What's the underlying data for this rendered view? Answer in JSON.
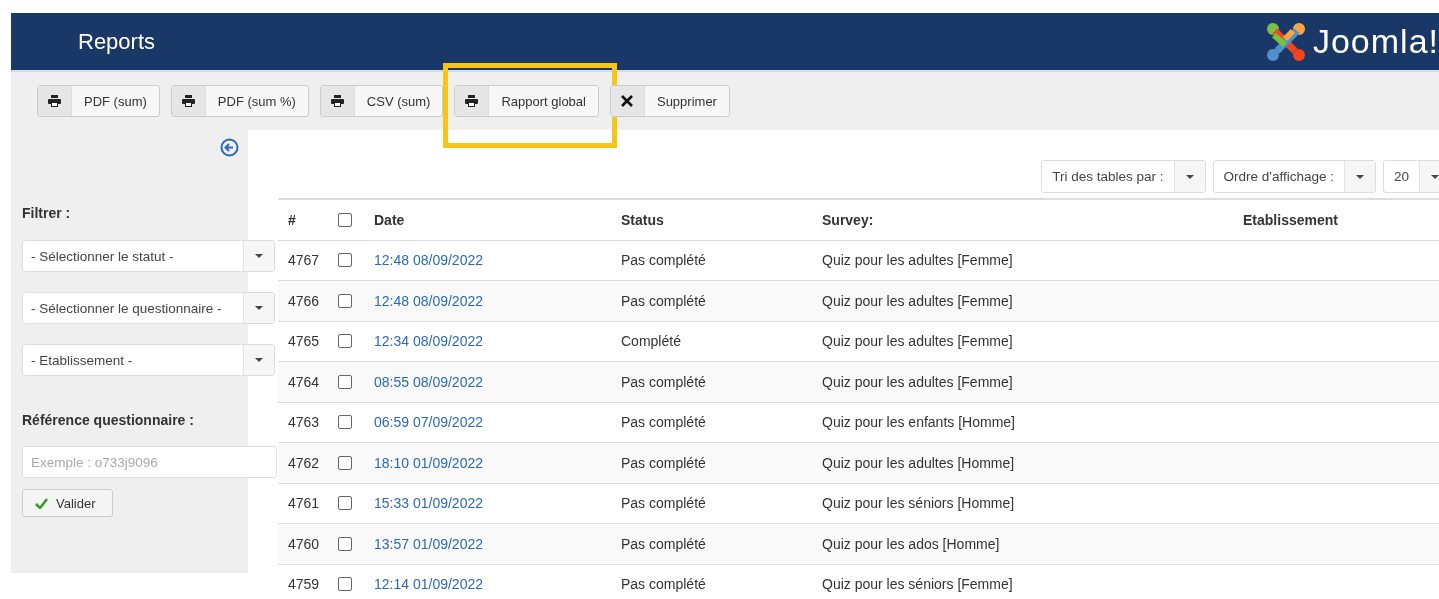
{
  "header": {
    "title": "Reports",
    "brand": "Joomla!"
  },
  "toolbar": [
    {
      "label": "PDF (sum)",
      "kind": "print",
      "highlighted": false
    },
    {
      "label": "PDF (sum %)",
      "kind": "print",
      "highlighted": false
    },
    {
      "label": "CSV (sum)",
      "kind": "print",
      "highlighted": false
    },
    {
      "label": "Rapport global",
      "kind": "print",
      "highlighted": true
    },
    {
      "label": "Supprimer",
      "kind": "delete",
      "highlighted": false
    }
  ],
  "sidebar": {
    "filter_label": "Filtrer :",
    "selects": [
      "- Sélectionner le statut -",
      "- Sélectionner le questionnaire -",
      "- Etablissement -"
    ],
    "reference_label": "Référence questionnaire :",
    "reference_placeholder": "Exemple : o733j9096",
    "submit": "Valider"
  },
  "list_controls": [
    {
      "label": "Tri des tables par :"
    },
    {
      "label": "Ordre d'affichage :"
    },
    {
      "label": "20"
    }
  ],
  "table": {
    "columns": [
      "#",
      "Date",
      "Status",
      "Survey:",
      "Etablissement"
    ],
    "select_all_checked": false,
    "rows": [
      {
        "id": "4767",
        "checked": false,
        "date": "12:48 08/09/2022",
        "status": "Pas complété",
        "survey": "Quiz pour les adultes [Femme]"
      },
      {
        "id": "4766",
        "checked": false,
        "date": "12:48 08/09/2022",
        "status": "Pas complété",
        "survey": "Quiz pour les adultes [Femme]"
      },
      {
        "id": "4765",
        "checked": false,
        "date": "12:34 08/09/2022",
        "status": "Complété",
        "survey": "Quiz pour les adultes [Femme]"
      },
      {
        "id": "4764",
        "checked": false,
        "date": "08:55 08/09/2022",
        "status": "Pas complété",
        "survey": "Quiz pour les adultes [Femme]"
      },
      {
        "id": "4763",
        "checked": false,
        "date": "06:59 07/09/2022",
        "status": "Pas complété",
        "survey": "Quiz pour les enfants [Homme]"
      },
      {
        "id": "4762",
        "checked": false,
        "date": "18:10 01/09/2022",
        "status": "Pas complété",
        "survey": "Quiz pour les adultes [Homme]"
      },
      {
        "id": "4761",
        "checked": false,
        "date": "15:33 01/09/2022",
        "status": "Pas complété",
        "survey": "Quiz pour les séniors [Homme]"
      },
      {
        "id": "4760",
        "checked": false,
        "date": "13:57 01/09/2022",
        "status": "Pas complété",
        "survey": "Quiz pour les ados [Homme]"
      },
      {
        "id": "4759",
        "checked": false,
        "date": "12:14 01/09/2022",
        "status": "Pas complété",
        "survey": "Quiz pour les séniors [Femme]"
      }
    ]
  }
}
